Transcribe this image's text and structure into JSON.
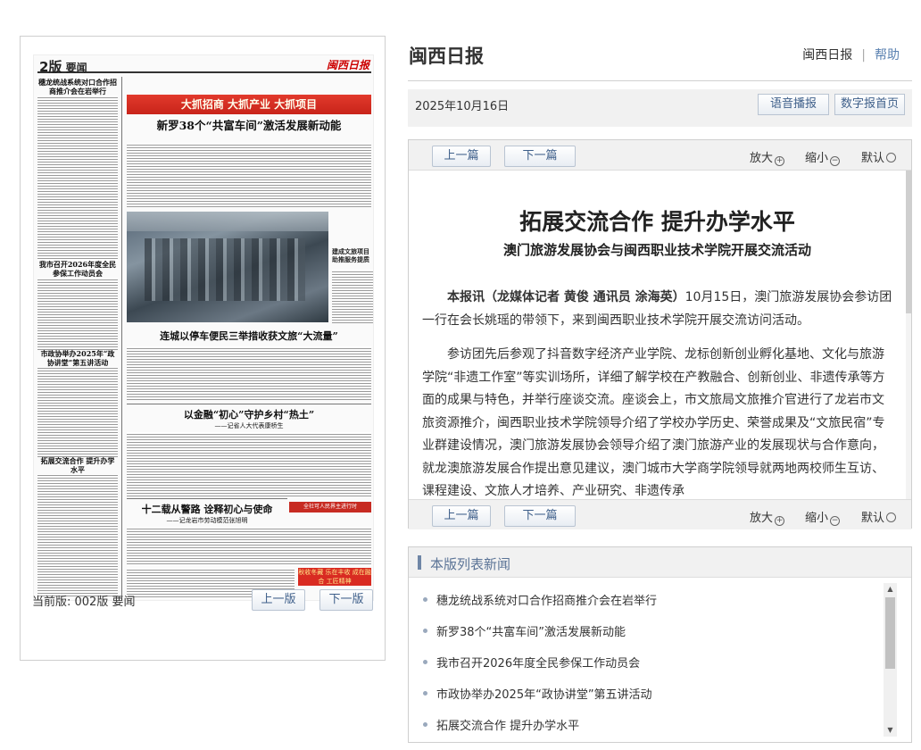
{
  "newspaper": {
    "page_no": "2版",
    "section": "要闻",
    "masthead": "闽西日报",
    "banner": "大抓招商  大抓产业  大抓项目",
    "headline_main": "新罗38个“共富车间”激活发展新动能",
    "headline_left1": "穗龙统战系统对口合作招商推介会在岩举行",
    "headline_left2": "我市召开2026年度全民参保工作动员会",
    "headline_left3": "市政协举办2025年“政协讲堂”第五讲活动",
    "headline_left4": "拓展交流合作 提升办学水平",
    "headline_photo": "连城以停车便民三举措收获文旅“大流量”",
    "headline_side": "建成文旅项目 助推服务提质",
    "headline_finance": "以金融“初心”守护乡村“热土”",
    "headline_finance_sub": "——记省人大代表康桥生",
    "headline_bottom": "十二载从警路 诠释初心与使命",
    "headline_bottom_sub": "——记龙岩市劳动模范张旭明",
    "red_box": "全社可人民界主进行时",
    "ad_text": "秋收冬藏\n乐在丰收 成在融合 工匠精神"
  },
  "page_status": "当前版: 002版 要闻",
  "page_prev": "上一版",
  "page_next": "下一版",
  "site_title": "闽西日报",
  "top_link_home": "闽西日报",
  "top_link_help": "帮助",
  "date": "2025年10月16日",
  "btn_voice": "语音播报",
  "btn_home": "数字报首页",
  "toolbar": {
    "prev": "上一篇",
    "next": "下一篇",
    "zoom_in": "放大",
    "zoom_out": "缩小",
    "reset": "默认"
  },
  "article": {
    "title": "拓展交流合作 提升办学水平",
    "subtitle": "澳门旅游发展协会与闽西职业技术学院开展交流活动",
    "lead_bold": "本报讯（龙媒体记者 黄俊 通讯员 涂海英）",
    "lead_rest": "10月15日，澳门旅游发展协会参访团一行在会长姚瑶的带领下，来到闽西职业技术学院开展交流访问活动。",
    "p2": "参访团先后参观了抖音数字经济产业学院、龙标创新创业孵化基地、文化与旅游学院“非遗工作室”等实训场所，详细了解学校在产教融合、创新创业、非遗传承等方面的成果与特色，并举行座谈交流。座谈会上，市文旅局文旅推介官进行了龙岩市文旅资源推介，闽西职业技术学院领导介绍了学校办学历史、荣誉成果及“文旅民宿”专业群建设情况，澳门旅游发展协会领导介绍了澳门旅游产业的发展现状与合作意向，就龙澳旅游发展合作提出意见建议，澳门城市大学商学院领导就两地两校师生互访、课程建设、文旅人才培养、产业研究、非遗传承"
  },
  "list_title": "本版列表新闻",
  "news_list": [
    "穗龙统战系统对口合作招商推介会在岩举行",
    "新罗38个“共富车间”激活发展新动能",
    "我市召开2026年度全民参保工作动员会",
    "市政协举办2025年“政协讲堂”第五讲活动",
    "拓展交流合作 提升办学水平"
  ],
  "colors": {
    "link": "#3e5f8a",
    "accent": "#6f86a6",
    "banner_red": "#d92b22"
  },
  "icons": [
    "zoom-in-icon",
    "zoom-out-icon",
    "reset-icon",
    "scroll-up-icon",
    "scroll-down-icon"
  ]
}
